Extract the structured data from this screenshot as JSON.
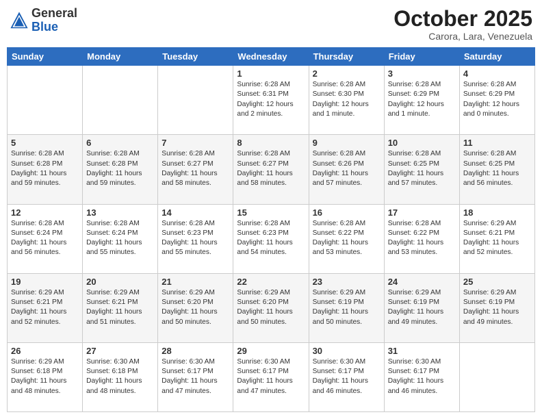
{
  "header": {
    "logo_general": "General",
    "logo_blue": "Blue",
    "month": "October 2025",
    "location": "Carora, Lara, Venezuela"
  },
  "weekdays": [
    "Sunday",
    "Monday",
    "Tuesday",
    "Wednesday",
    "Thursday",
    "Friday",
    "Saturday"
  ],
  "weeks": [
    [
      {
        "day": "",
        "info": ""
      },
      {
        "day": "",
        "info": ""
      },
      {
        "day": "",
        "info": ""
      },
      {
        "day": "1",
        "info": "Sunrise: 6:28 AM\nSunset: 6:31 PM\nDaylight: 12 hours\nand 2 minutes."
      },
      {
        "day": "2",
        "info": "Sunrise: 6:28 AM\nSunset: 6:30 PM\nDaylight: 12 hours\nand 1 minute."
      },
      {
        "day": "3",
        "info": "Sunrise: 6:28 AM\nSunset: 6:29 PM\nDaylight: 12 hours\nand 1 minute."
      },
      {
        "day": "4",
        "info": "Sunrise: 6:28 AM\nSunset: 6:29 PM\nDaylight: 12 hours\nand 0 minutes."
      }
    ],
    [
      {
        "day": "5",
        "info": "Sunrise: 6:28 AM\nSunset: 6:28 PM\nDaylight: 11 hours\nand 59 minutes."
      },
      {
        "day": "6",
        "info": "Sunrise: 6:28 AM\nSunset: 6:28 PM\nDaylight: 11 hours\nand 59 minutes."
      },
      {
        "day": "7",
        "info": "Sunrise: 6:28 AM\nSunset: 6:27 PM\nDaylight: 11 hours\nand 58 minutes."
      },
      {
        "day": "8",
        "info": "Sunrise: 6:28 AM\nSunset: 6:27 PM\nDaylight: 11 hours\nand 58 minutes."
      },
      {
        "day": "9",
        "info": "Sunrise: 6:28 AM\nSunset: 6:26 PM\nDaylight: 11 hours\nand 57 minutes."
      },
      {
        "day": "10",
        "info": "Sunrise: 6:28 AM\nSunset: 6:25 PM\nDaylight: 11 hours\nand 57 minutes."
      },
      {
        "day": "11",
        "info": "Sunrise: 6:28 AM\nSunset: 6:25 PM\nDaylight: 11 hours\nand 56 minutes."
      }
    ],
    [
      {
        "day": "12",
        "info": "Sunrise: 6:28 AM\nSunset: 6:24 PM\nDaylight: 11 hours\nand 56 minutes."
      },
      {
        "day": "13",
        "info": "Sunrise: 6:28 AM\nSunset: 6:24 PM\nDaylight: 11 hours\nand 55 minutes."
      },
      {
        "day": "14",
        "info": "Sunrise: 6:28 AM\nSunset: 6:23 PM\nDaylight: 11 hours\nand 55 minutes."
      },
      {
        "day": "15",
        "info": "Sunrise: 6:28 AM\nSunset: 6:23 PM\nDaylight: 11 hours\nand 54 minutes."
      },
      {
        "day": "16",
        "info": "Sunrise: 6:28 AM\nSunset: 6:22 PM\nDaylight: 11 hours\nand 53 minutes."
      },
      {
        "day": "17",
        "info": "Sunrise: 6:28 AM\nSunset: 6:22 PM\nDaylight: 11 hours\nand 53 minutes."
      },
      {
        "day": "18",
        "info": "Sunrise: 6:29 AM\nSunset: 6:21 PM\nDaylight: 11 hours\nand 52 minutes."
      }
    ],
    [
      {
        "day": "19",
        "info": "Sunrise: 6:29 AM\nSunset: 6:21 PM\nDaylight: 11 hours\nand 52 minutes."
      },
      {
        "day": "20",
        "info": "Sunrise: 6:29 AM\nSunset: 6:21 PM\nDaylight: 11 hours\nand 51 minutes."
      },
      {
        "day": "21",
        "info": "Sunrise: 6:29 AM\nSunset: 6:20 PM\nDaylight: 11 hours\nand 50 minutes."
      },
      {
        "day": "22",
        "info": "Sunrise: 6:29 AM\nSunset: 6:20 PM\nDaylight: 11 hours\nand 50 minutes."
      },
      {
        "day": "23",
        "info": "Sunrise: 6:29 AM\nSunset: 6:19 PM\nDaylight: 11 hours\nand 50 minutes."
      },
      {
        "day": "24",
        "info": "Sunrise: 6:29 AM\nSunset: 6:19 PM\nDaylight: 11 hours\nand 49 minutes."
      },
      {
        "day": "25",
        "info": "Sunrise: 6:29 AM\nSunset: 6:19 PM\nDaylight: 11 hours\nand 49 minutes."
      }
    ],
    [
      {
        "day": "26",
        "info": "Sunrise: 6:29 AM\nSunset: 6:18 PM\nDaylight: 11 hours\nand 48 minutes."
      },
      {
        "day": "27",
        "info": "Sunrise: 6:30 AM\nSunset: 6:18 PM\nDaylight: 11 hours\nand 48 minutes."
      },
      {
        "day": "28",
        "info": "Sunrise: 6:30 AM\nSunset: 6:17 PM\nDaylight: 11 hours\nand 47 minutes."
      },
      {
        "day": "29",
        "info": "Sunrise: 6:30 AM\nSunset: 6:17 PM\nDaylight: 11 hours\nand 47 minutes."
      },
      {
        "day": "30",
        "info": "Sunrise: 6:30 AM\nSunset: 6:17 PM\nDaylight: 11 hours\nand 46 minutes."
      },
      {
        "day": "31",
        "info": "Sunrise: 6:30 AM\nSunset: 6:17 PM\nDaylight: 11 hours\nand 46 minutes."
      },
      {
        "day": "",
        "info": ""
      }
    ]
  ]
}
